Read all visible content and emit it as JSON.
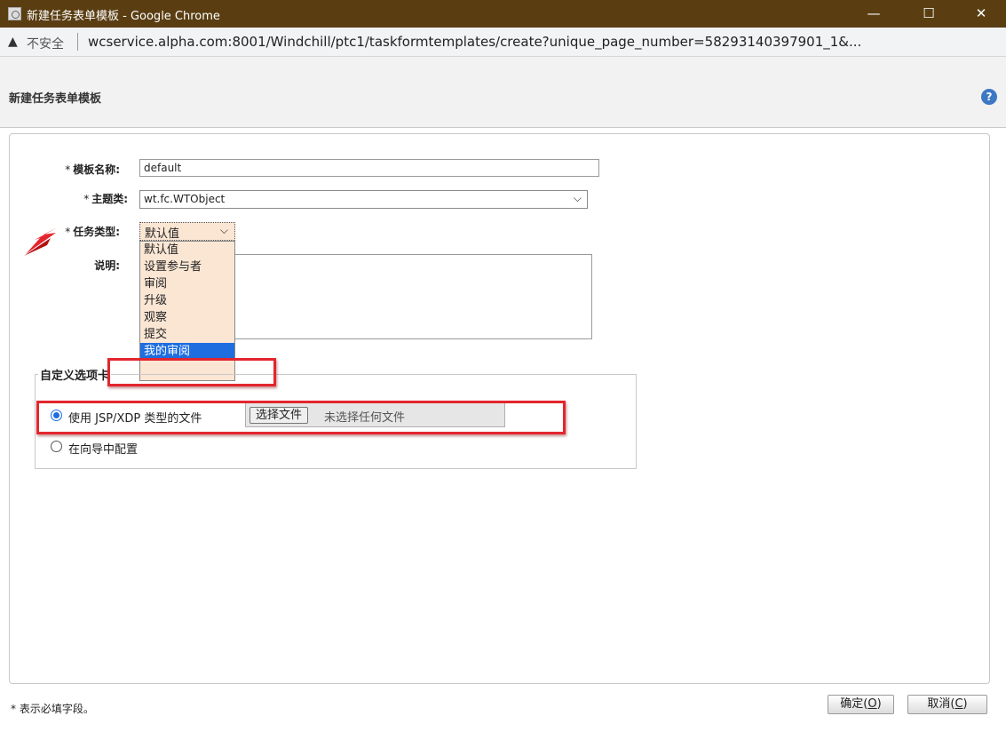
{
  "window": {
    "title": "新建任务表单模板 - Google Chrome",
    "minimize_glyph": "—",
    "maximize_glyph": "☐",
    "close_glyph": "✕"
  },
  "address_bar": {
    "warning_icon": "warning-icon",
    "security_label": "不安全",
    "url": "wcservice.alpha.com:8001/Windchill/ptc1/taskformtemplates/create?unique_page_number=58293140397901_1&..."
  },
  "page": {
    "title": "新建任务表单模板",
    "help_glyph": "?"
  },
  "form": {
    "required_mark": "*",
    "template_name": {
      "label": "模板名称:",
      "value": "default"
    },
    "subject_class": {
      "label": "主题类:",
      "value": "wt.fc.WTObject"
    },
    "task_type": {
      "label": "任务类型:",
      "value": "默认值",
      "options": [
        "默认值",
        "设置参与者",
        "审阅",
        "升级",
        "观察",
        "提交",
        "我的审阅"
      ],
      "highlighted_index": 6
    },
    "description": {
      "label": "说明:",
      "value": ""
    },
    "custom_tab": {
      "legend": "自定义选项卡",
      "option_file": "使用 JSP/XDP 类型的文件",
      "option_wizard": "在向导中配置",
      "choose_file_button": "选择文件",
      "no_file_text": "未选择任何文件",
      "selected": "option_file"
    }
  },
  "footer": {
    "note": "* 表示必填字段。",
    "ok_label": "确定(",
    "ok_key": "O",
    "cancel_label": "取消(",
    "cancel_key": "C",
    "close_paren": ")"
  },
  "colors": {
    "titlebar": "#5a3e12",
    "highlight": "#1e6ee0",
    "annotation_red": "#e3262e",
    "dropdown_bg": "#fbe6d4"
  }
}
